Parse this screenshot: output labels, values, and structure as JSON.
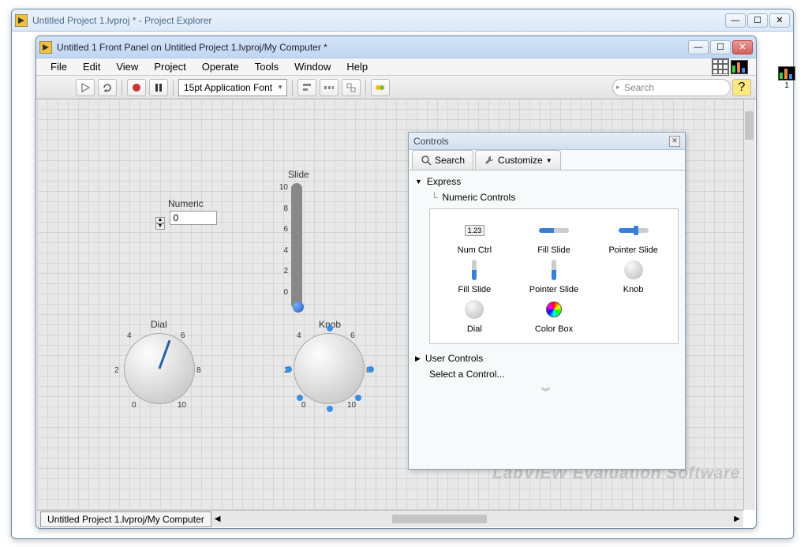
{
  "back_window": {
    "title": "Untitled Project 1.lvproj * - Project Explorer"
  },
  "front_window": {
    "title": "Untitled 1 Front Panel on Untitled Project 1.lvproj/My Computer *",
    "menus": [
      "File",
      "Edit",
      "View",
      "Project",
      "Operate",
      "Tools",
      "Window",
      "Help"
    ],
    "font": "15pt Application Font",
    "search_placeholder": "Search",
    "path_tab": "Untitled Project 1.lvproj/My Computer"
  },
  "watermark": "LabVIEW  Evaluation Software",
  "front_panel": {
    "numeric_label": "Numeric",
    "numeric_value": "0",
    "slide_label": "Slide",
    "slide_ticks": [
      "10",
      "8",
      "6",
      "4",
      "2",
      "0"
    ],
    "dial_label": "Dial",
    "knob_label": "Knob",
    "round_ticks": [
      "0",
      "2",
      "4",
      "6",
      "8",
      "10"
    ]
  },
  "palette": {
    "title": "Controls",
    "search": "Search",
    "customize": "Customize",
    "express": "Express",
    "sub_cat": "Numeric Controls",
    "items": [
      "Num Ctrl",
      "Fill Slide",
      "Pointer Slide",
      "Fill Slide",
      "Pointer Slide",
      "Knob",
      "Dial",
      "Color Box"
    ],
    "user_controls": "User Controls",
    "select": "Select a Control..."
  }
}
